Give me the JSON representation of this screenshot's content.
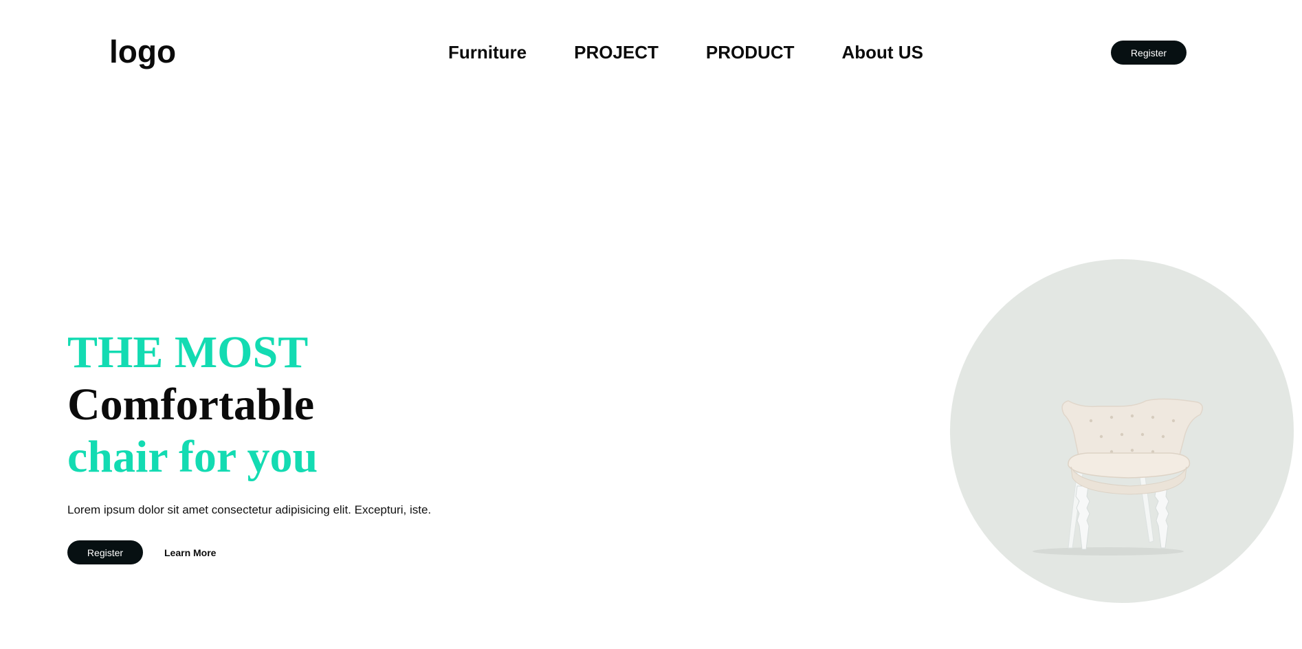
{
  "header": {
    "logo": "logo",
    "nav": [
      "Furniture",
      "PROJECT",
      "PRODUCT",
      "About US"
    ],
    "register_label": "Register"
  },
  "hero": {
    "title_line1": "THE MOST",
    "title_line2": "Comfortable",
    "title_line3": "chair for you",
    "description": "Lorem ipsum dolor sit amet consectetur adipisicing elit. Excepturi, iste.",
    "register_label": "Register",
    "learn_more_label": "Learn More",
    "image_icon": "armchair-image"
  },
  "colors": {
    "accent": "#13dbb2",
    "dark_button": "#071012",
    "circle_bg": "#e3e7e3"
  }
}
